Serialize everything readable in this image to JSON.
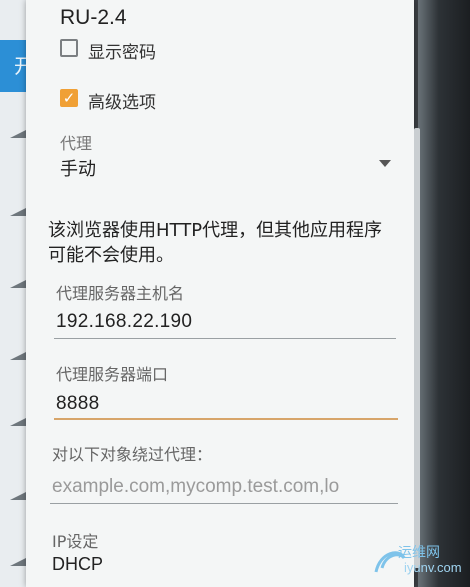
{
  "dialog": {
    "title": "RU-2.4",
    "show_password_label": "显示密码",
    "advanced_options_label": "高级选项",
    "proxy": {
      "label": "代理",
      "value": "手动",
      "note": "该浏览器使用HTTP代理，但其他应用程序可能不会使用。"
    },
    "proxy_hostname": {
      "label": "代理服务器主机名",
      "value": "192.168.22.190"
    },
    "proxy_port": {
      "label": "代理服务器端口",
      "value": "8888"
    },
    "bypass": {
      "label": "对以下对象绕过代理：",
      "placeholder": "example.com,mycomp.test.com,lo"
    },
    "ip_settings": {
      "label": "IP设定",
      "value": "DHCP"
    }
  },
  "background": {
    "header_text": "开"
  },
  "watermark": {
    "brand_cn": "运维网",
    "brand_en": "iyunv.com"
  },
  "colors": {
    "accent": "#f0a035",
    "header_blue": "#2c8fd6"
  },
  "icons": [
    "wifi-icon",
    "checkbox-icon",
    "dropdown-arrow-icon"
  ]
}
